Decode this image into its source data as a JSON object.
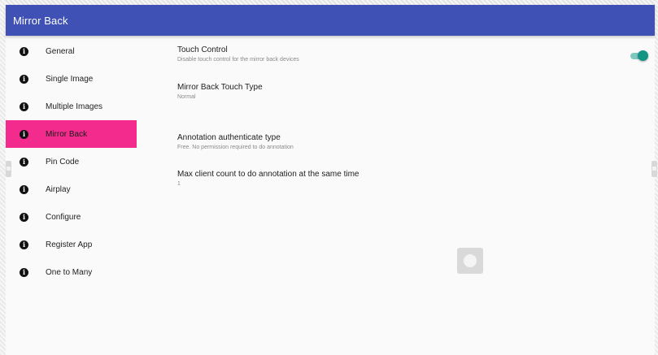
{
  "appbar": {
    "title": "Mirror Back",
    "color": "#3f51b5"
  },
  "sidebar": {
    "icon": "info-icon",
    "active_color": "#f22b8d",
    "items": [
      {
        "label": "General"
      },
      {
        "label": "Single Image"
      },
      {
        "label": "Multiple Images"
      },
      {
        "label": "Mirror Back",
        "active": true
      },
      {
        "label": "Pin Code"
      },
      {
        "label": "Airplay"
      },
      {
        "label": "Configure"
      },
      {
        "label": "Register App"
      },
      {
        "label": "One to Many"
      }
    ]
  },
  "preferences": [
    {
      "title": "Touch Control",
      "summary": "Disable touch control for the mirror back devices",
      "toggle": true,
      "toggle_on": true
    },
    {
      "title": "Mirror Back Touch Type",
      "summary": "Normal"
    },
    {
      "title": "Annotation authenticate type",
      "summary": "Free. No permission required to do annotation"
    },
    {
      "title": "Max client count to do annotation at the same time",
      "summary": "1"
    }
  ],
  "colors": {
    "toggle_on": "#139485"
  }
}
